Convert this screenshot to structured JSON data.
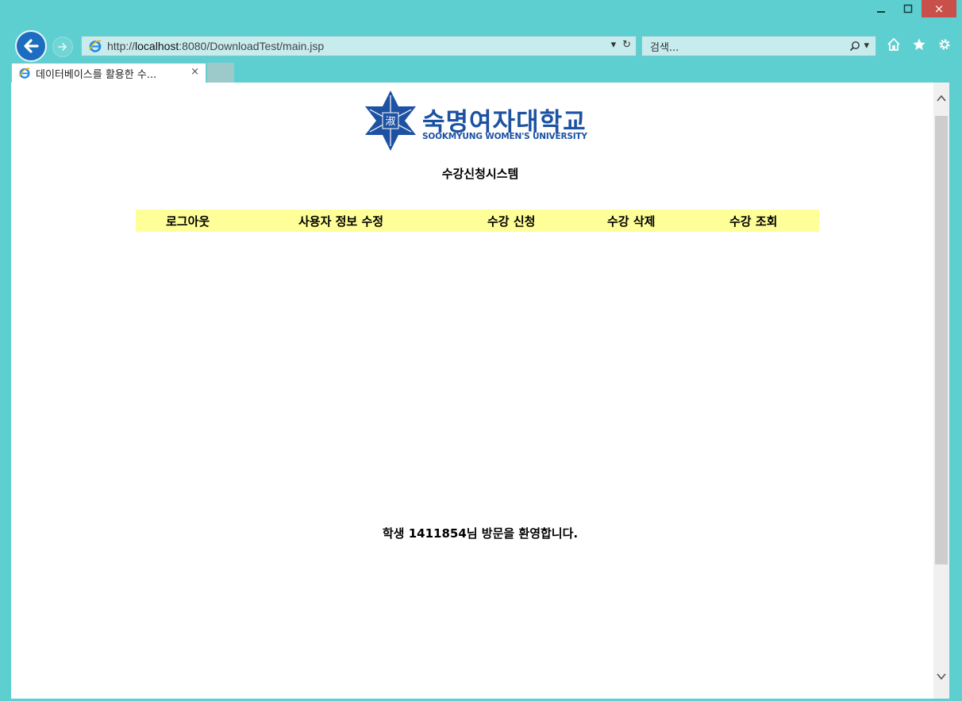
{
  "window": {
    "minimize_glyph": "‒",
    "maximize_glyph": "☐",
    "close_glyph": "×"
  },
  "addressbar": {
    "url_prefix": "http://",
    "url_host": "localhost",
    "url_rest": ":8080/DownloadTest/main.jsp",
    "dropdown_glyph": "▾",
    "refresh_glyph": "↻"
  },
  "searchbar": {
    "placeholder": "검색...",
    "search_glyph": "⌕",
    "dropdown_glyph": "▾"
  },
  "tab": {
    "title": "데이터베이스를 활용한 수...",
    "close_glyph": "×"
  },
  "page": {
    "logo_text_ko": "숙명여자대학교",
    "logo_text_en": "SOOKMYUNG WOMEN'S UNIVERSITY",
    "system_title": "수강신청시스템",
    "menu": [
      {
        "label": "로그아웃"
      },
      {
        "label": "사용자 정보 수정"
      },
      {
        "label": "수강 신청"
      },
      {
        "label": "수강 삭제"
      },
      {
        "label": "수강 조회"
      }
    ],
    "welcome": "학생 1411854님 방문을 환영합니다."
  },
  "scrollbar": {
    "up_glyph": "^",
    "down_glyph": "v"
  },
  "colors": {
    "chrome": "#5ecfd0",
    "menu_bg": "#ffff99",
    "logo_blue": "#1d52a3",
    "close_red": "#c9504a"
  }
}
